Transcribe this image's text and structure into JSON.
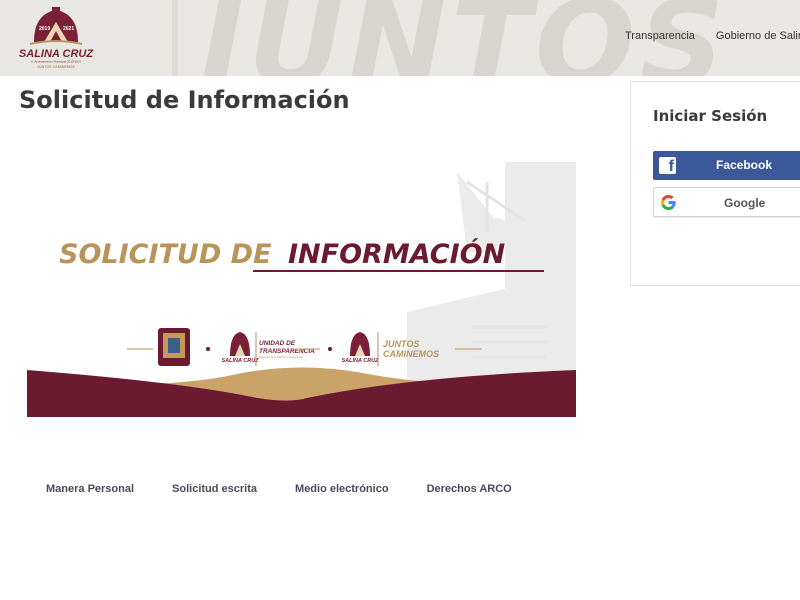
{
  "header": {
    "logo": {
      "years": [
        "2019",
        "2021"
      ],
      "name": "SALINA CRUZ",
      "subtitle": "H. Ayuntamiento Municipal 2019-2021",
      "motto": "JUNTOS CAMINEMOS"
    },
    "background_word": "JUNTOS",
    "nav": [
      "Transparencia",
      "Gobierno de Salina"
    ]
  },
  "page_title": "Solicitud de Información",
  "banner": {
    "heading_part1": "SOLICITUD DE",
    "heading_part2": "INFORMACIÓN",
    "unidad_line1": "UNIDAD DE",
    "unidad_line2": "TRANSPARENCIA",
    "unidad_sub": "Dirección de Unidad de Transparencia",
    "juntos_line1": "JUNTOS",
    "juntos_line2": "CAMINEMOS",
    "logo_name": "SALINA CRUZ",
    "colors": {
      "gold": "#b8935a",
      "maroon": "#6b1a30"
    }
  },
  "tabs": [
    "Manera Personal",
    "Solicitud escrita",
    "Medio electrónico",
    "Derechos ARCO"
  ],
  "login": {
    "title": "Iniciar Sesión",
    "facebook_label": "Facebook",
    "google_label": "Google",
    "colors": {
      "facebook": "#3b5998"
    }
  }
}
